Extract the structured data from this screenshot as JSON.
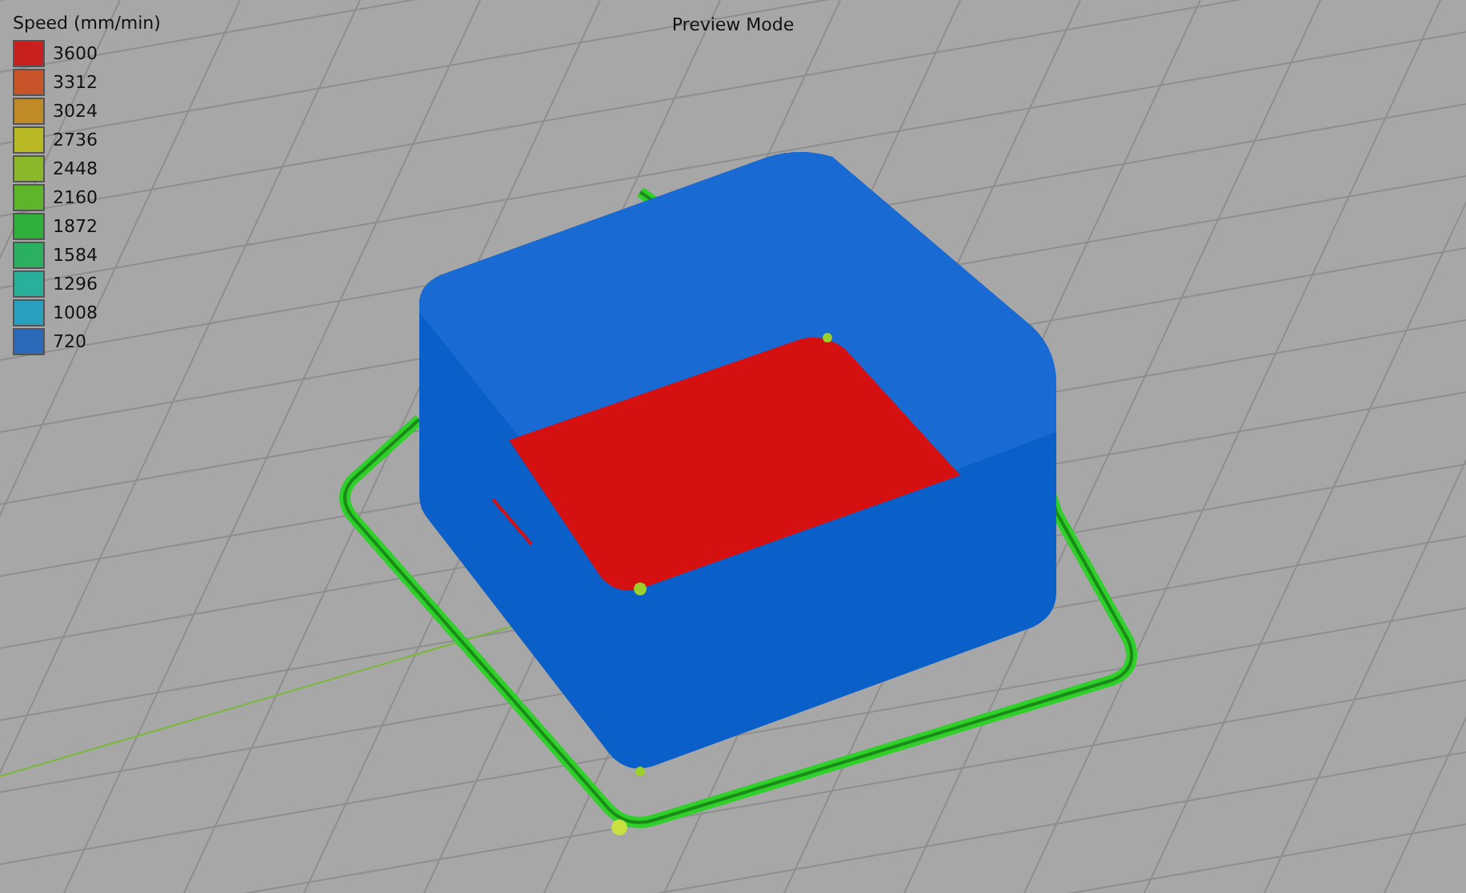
{
  "legend": {
    "title": "Speed (mm/min)",
    "items": [
      {
        "label": "3600",
        "color": "#c8201f"
      },
      {
        "label": "3312",
        "color": "#c8542a"
      },
      {
        "label": "3024",
        "color": "#c08a26"
      },
      {
        "label": "2736",
        "color": "#b8b923"
      },
      {
        "label": "2448",
        "color": "#8ab82a"
      },
      {
        "label": "2160",
        "color": "#5fb52a"
      },
      {
        "label": "1872",
        "color": "#2fb03a"
      },
      {
        "label": "1584",
        "color": "#2ab060"
      },
      {
        "label": "1296",
        "color": "#28b09a"
      },
      {
        "label": "1008",
        "color": "#2aa0c0"
      },
      {
        "label": "720",
        "color": "#2a6ab8"
      }
    ]
  },
  "view": {
    "title": "Preview Mode"
  }
}
